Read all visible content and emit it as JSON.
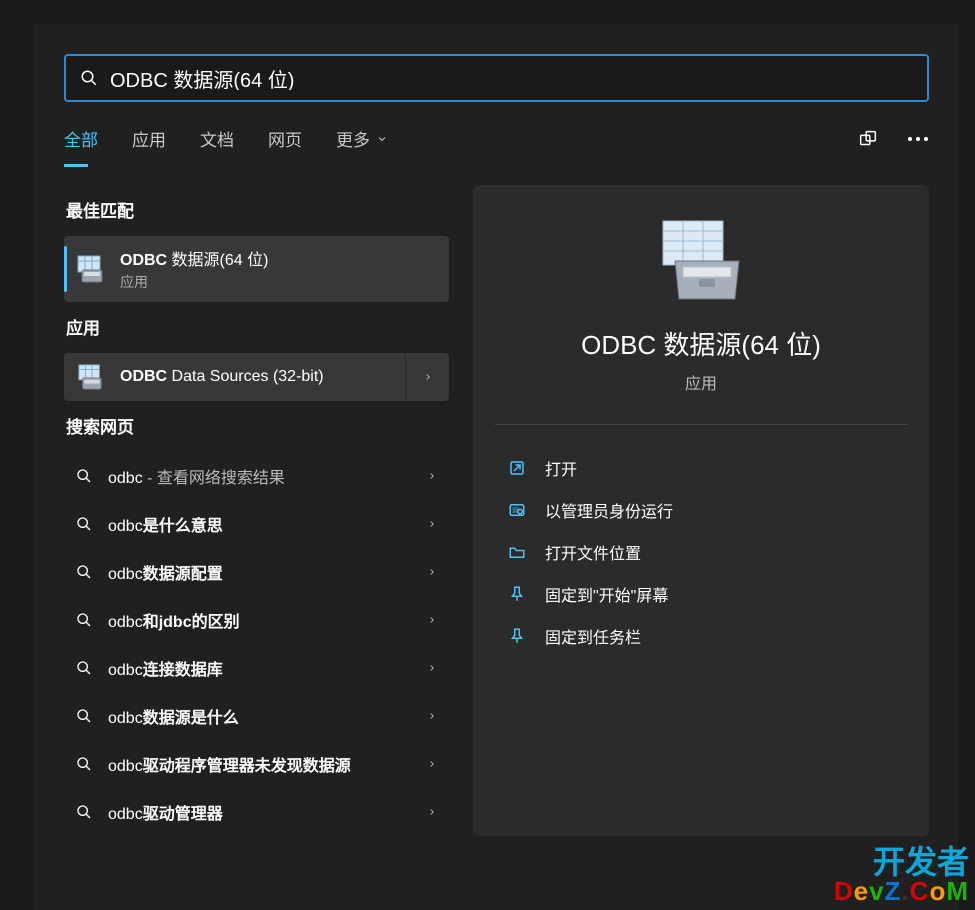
{
  "search": {
    "value": "ODBC 数据源(64 位)"
  },
  "tabs": {
    "items": [
      "全部",
      "应用",
      "文档",
      "网页",
      "更多"
    ],
    "active_index": 0
  },
  "sections": {
    "best_match": "最佳匹配",
    "apps": "应用",
    "web": "搜索网页"
  },
  "best_match": {
    "title_bold": "ODBC",
    "title_rest": " 数据源(64 位)",
    "subtitle": "应用"
  },
  "apps": [
    {
      "title_bold": "ODBC",
      "title_rest": " Data Sources (32-bit)"
    }
  ],
  "web_results": [
    {
      "prefix": "odbc",
      "bold": "",
      "suffix": " - 查看网络搜索结果"
    },
    {
      "prefix": "odbc",
      "bold": "是什么意思",
      "suffix": ""
    },
    {
      "prefix": "odbc",
      "bold": "数据源配置",
      "suffix": ""
    },
    {
      "prefix": "odbc",
      "bold": "和jdbc的区别",
      "suffix": ""
    },
    {
      "prefix": "odbc",
      "bold": "连接数据库",
      "suffix": ""
    },
    {
      "prefix": "odbc",
      "bold": "数据源是什么",
      "suffix": ""
    },
    {
      "prefix": "odbc",
      "bold": "驱动程序管理器未发现数据源",
      "suffix": ""
    },
    {
      "prefix": "odbc",
      "bold": "驱动管理器",
      "suffix": ""
    }
  ],
  "detail": {
    "title": "ODBC 数据源(64 位)",
    "subtitle": "应用",
    "actions": [
      {
        "icon": "open",
        "label": "打开"
      },
      {
        "icon": "admin",
        "label": "以管理员身份运行"
      },
      {
        "icon": "folder",
        "label": "打开文件位置"
      },
      {
        "icon": "pin",
        "label": "固定到\"开始\"屏幕"
      },
      {
        "icon": "pin",
        "label": "固定到任务栏"
      }
    ]
  },
  "watermark": {
    "line1": "开发者",
    "line2": "DevZ.CoM"
  }
}
